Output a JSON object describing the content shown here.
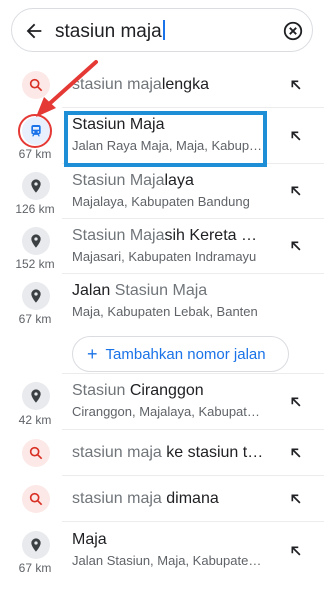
{
  "search": {
    "query_normal": "stasiun maja",
    "back_icon": "arrow-back-icon",
    "clear_icon": "clear-x-icon"
  },
  "suggestions": [
    {
      "icon": "search-icon",
      "title_light": "stasiun maja",
      "title_bold": "lengka",
      "subtitle": "",
      "distance": ""
    },
    {
      "icon": "train-icon",
      "title_light": "",
      "title_bold": "Stasiun Maja",
      "subtitle": "Jalan Raya Maja, Maja, Kabupaten Lebak",
      "distance": "67 km"
    },
    {
      "icon": "place-pin-icon",
      "title_light": "Stasiun Maja",
      "title_bold": "laya",
      "subtitle": "Majalaya, Kabupaten Bandung",
      "distance": "126 km"
    },
    {
      "icon": "place-pin-icon",
      "title_light": "Stasiun Maja",
      "title_bold": "sih Kereta Bandung",
      "subtitle": "Majasari, Kabupaten Indramayu",
      "distance": "152 km"
    },
    {
      "icon": "place-pin-icon",
      "title_bold": "Jalan ",
      "title_light": "Stasiun Maja",
      "subtitle": "Maja, Kabupaten Lebak, Banten",
      "distance": "67 km"
    },
    {
      "icon": "place-pin-icon",
      "title_light": "Stasiun ",
      "title_bold": "Ciranggon",
      "subtitle": "Ciranggon, Majalaya, Kabupaten Karawang",
      "distance": "42 km"
    },
    {
      "icon": "search-icon",
      "title_light": "stasiun maja",
      "title_bold": " ke stasiun tanah abang",
      "subtitle": "",
      "distance": ""
    },
    {
      "icon": "search-icon",
      "title_light": "stasiun maja",
      "title_bold": " dimana",
      "subtitle": "",
      "distance": ""
    },
    {
      "icon": "place-pin-icon",
      "title_light": "",
      "title_bold": "Maja",
      "subtitle": "Jalan Stasiun, Maja, Kabupaten Lebak",
      "distance": "67 km"
    }
  ],
  "add_street_button": "Tambahkan nomor jalan",
  "fill_icon": "arrow-up-left-icon",
  "colors": {
    "accent": "#1a73e8",
    "annotation_red": "#e53935",
    "annotation_blue": "#1e8fd6"
  }
}
